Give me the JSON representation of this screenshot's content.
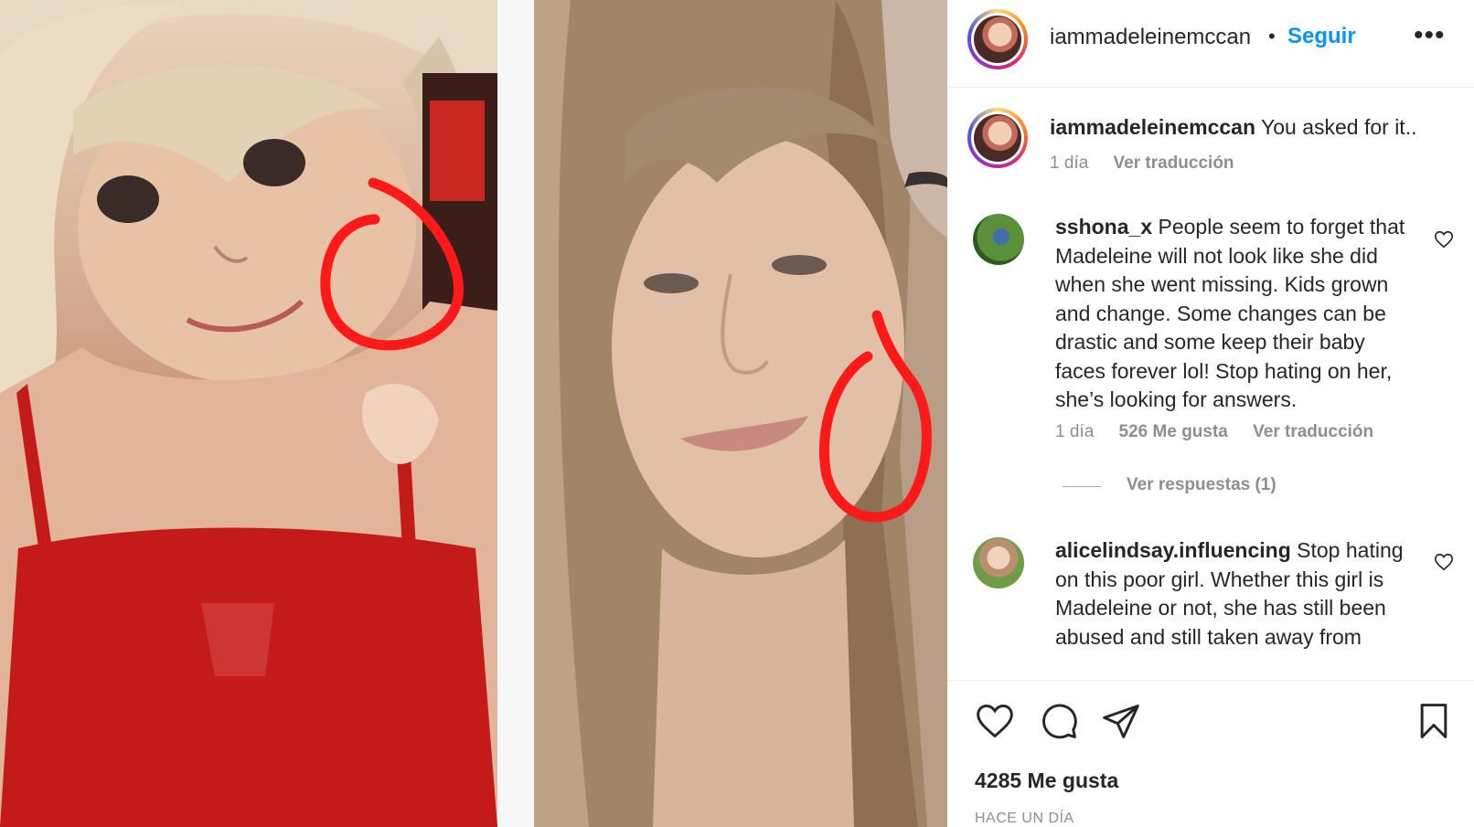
{
  "post": {
    "username": "iammadeleinemccan",
    "dot": "•",
    "follow_label": "Seguir",
    "more_label": "•••"
  },
  "caption": {
    "username": "iammadeleinemccan",
    "text": "You asked for it..",
    "time": "1 día",
    "translate_label": "Ver traducción"
  },
  "comments": [
    {
      "username": "sshona_x",
      "text": "People seem to forget that Madeleine will not look like she did when she went missing. Kids grown and change. Some changes can be drastic and some keep their baby faces forever lol! Stop hating on her, she’s looking for answers.",
      "time": "1 día",
      "likes": "526 Me gusta",
      "translate_label": "Ver traducción",
      "replies_label": "Ver respuestas (1)"
    },
    {
      "username": "alicelindsay.influencing",
      "text": "Stop hating on this poor girl. Whether this girl is Madeleine or not, she has still been abused and still taken away from"
    }
  ],
  "footer": {
    "likes_count": "4285 Me gusta",
    "time_ago": "HACE UN DÍA"
  },
  "icons": {
    "like": "heart-icon",
    "comment": "comment-icon",
    "share": "share-icon",
    "save": "bookmark-icon",
    "comment_like": "heart-icon"
  },
  "colors": {
    "accent": "#0095f6",
    "text": "#262626",
    "muted": "#8e8e8e",
    "annotation_circle": "#ff1a1a"
  }
}
